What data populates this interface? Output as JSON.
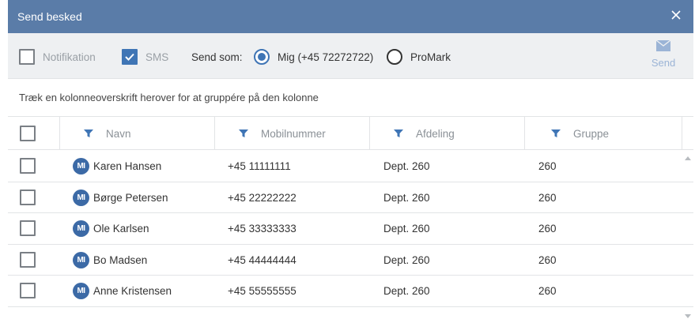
{
  "dialog": {
    "title": "Send besked",
    "close_icon": "close-icon"
  },
  "toolbar": {
    "notification_label": "Notifikation",
    "notification_checked": false,
    "sms_label": "SMS",
    "sms_checked": true,
    "send_as_label": "Send som:",
    "send_as_options": [
      {
        "label": "Mig (+45 72272722)",
        "selected": true
      },
      {
        "label": "ProMark",
        "selected": false
      }
    ],
    "send_label": "Send",
    "send_icon": "envelope-icon"
  },
  "group_hint": "Træk en kolonneoverskrift herover for at gruppére på den kolonne",
  "grid": {
    "columns": [
      "Navn",
      "Mobilnummer",
      "Afdeling",
      "Gruppe"
    ],
    "filter_icon": "filter-icon",
    "avatar_initials": "MI",
    "rows": [
      {
        "name": "Karen Hansen",
        "mobile": "+45 11111111",
        "department": "Dept. 260",
        "group": "260"
      },
      {
        "name": "Børge Petersen",
        "mobile": "+45 22222222",
        "department": "Dept. 260",
        "group": "260"
      },
      {
        "name": "Ole Karlsen",
        "mobile": "+45 33333333",
        "department": "Dept. 260",
        "group": "260"
      },
      {
        "name": "Bo Madsen",
        "mobile": "+45 44444444",
        "department": "Dept. 260",
        "group": "260"
      },
      {
        "name": "Anne Kristensen",
        "mobile": "+45 55555555",
        "department": "Dept. 260",
        "group": "260"
      }
    ]
  },
  "colors": {
    "titlebar": "#5a7ca8",
    "accent": "#3f75b5",
    "avatar": "#3c6aa6",
    "send_disabled": "#9bb4d6"
  }
}
